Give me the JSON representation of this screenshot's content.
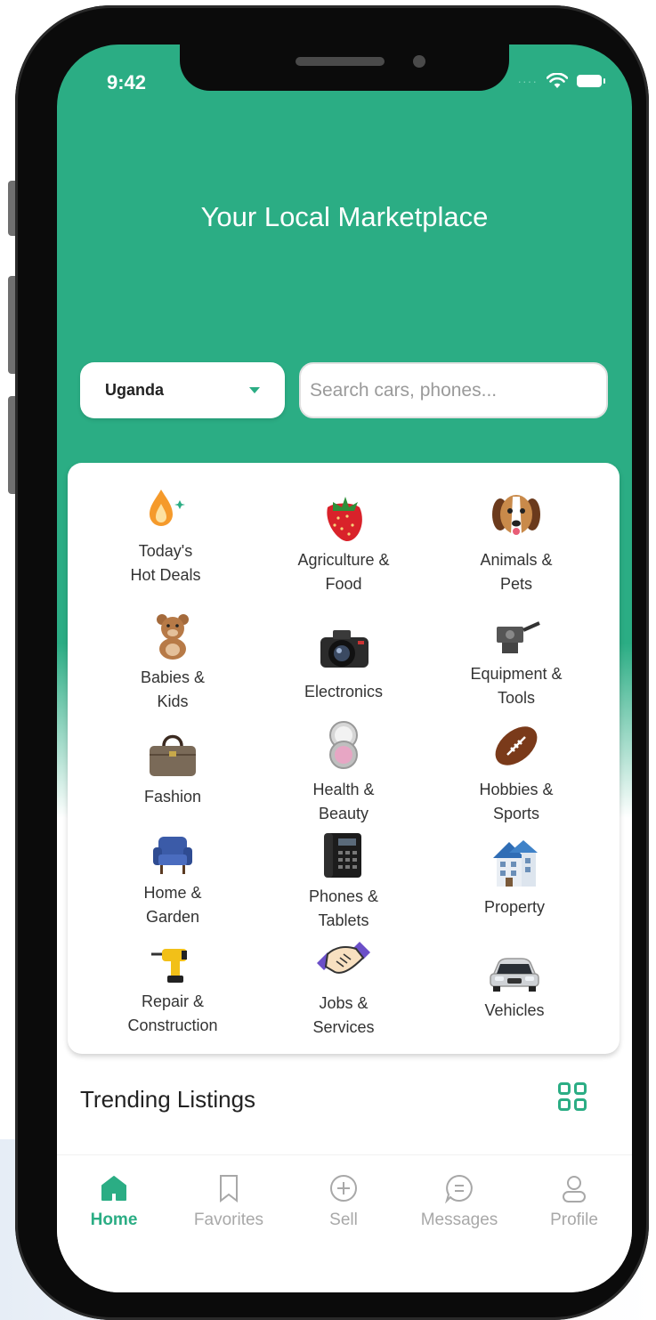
{
  "status": {
    "time": "9:42"
  },
  "header": {
    "title": "Your Local Marketplace"
  },
  "country_selector": {
    "selected": "Uganda"
  },
  "search": {
    "placeholder": "Search cars, phones..."
  },
  "categories": [
    {
      "label": "Today's\nHot Deals",
      "icon": "fire-icon"
    },
    {
      "label": "Agriculture &\nFood",
      "icon": "strawberry-icon"
    },
    {
      "label": "Animals &\nPets",
      "icon": "dog-icon"
    },
    {
      "label": "Babies &\nKids",
      "icon": "teddy-bear-icon"
    },
    {
      "label": "Electronics",
      "icon": "camera-icon"
    },
    {
      "label": "Equipment &\nTools",
      "icon": "machine-icon"
    },
    {
      "label": "Fashion",
      "icon": "handbag-icon"
    },
    {
      "label": "Health &\nBeauty",
      "icon": "compact-mirror-icon"
    },
    {
      "label": "Hobbies &\nSports",
      "icon": "football-icon"
    },
    {
      "label": "Home &\nGarden",
      "icon": "armchair-icon"
    },
    {
      "label": "Phones &\nTablets",
      "icon": "desk-phone-icon"
    },
    {
      "label": "Property",
      "icon": "building-icon"
    },
    {
      "label": "Repair &\nConstruction",
      "icon": "drill-icon"
    },
    {
      "label": "Jobs &\nServices",
      "icon": "handshake-icon"
    },
    {
      "label": "Vehicles",
      "icon": "car-icon"
    }
  ],
  "trending": {
    "title": "Trending Listings"
  },
  "nav": [
    {
      "label": "Home",
      "icon": "home-icon",
      "active": true
    },
    {
      "label": "Favorites",
      "icon": "bookmark-icon",
      "active": false
    },
    {
      "label": "Sell",
      "icon": "plus-circle-icon",
      "active": false
    },
    {
      "label": "Messages",
      "icon": "chat-icon",
      "active": false
    },
    {
      "label": "Profile",
      "icon": "user-icon",
      "active": false
    }
  ],
  "colors": {
    "brand": "#2bad84",
    "inactive": "#a8a8a8"
  }
}
